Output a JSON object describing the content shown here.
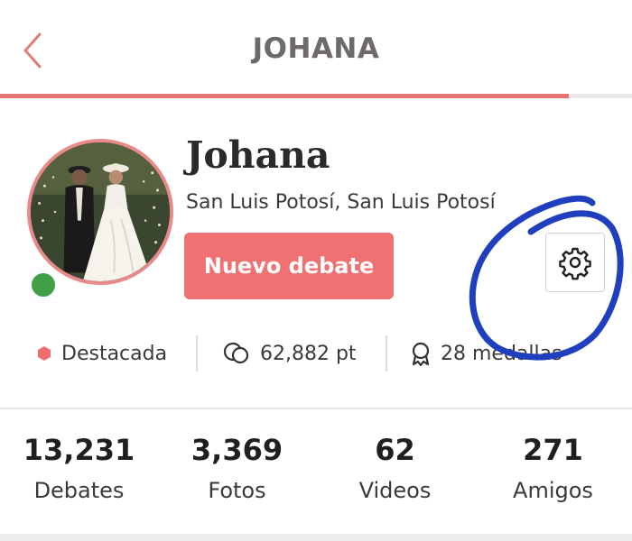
{
  "header": {
    "title": "JOHANA",
    "progress_fraction": 0.9
  },
  "profile": {
    "name": "Johana",
    "location": "San Luis Potosí, San Luis Potosí",
    "status": "online",
    "new_debate_label": "Nuevo debate"
  },
  "stats": [
    {
      "icon": "hexagon-icon",
      "label": "Destacada"
    },
    {
      "icon": "chat-bubbles-icon",
      "label": "62,882 pt"
    },
    {
      "icon": "medal-icon",
      "label": "28 medallas"
    }
  ],
  "counts": [
    {
      "value": "13,231",
      "label": "Debates"
    },
    {
      "value": "3,369",
      "label": "Fotos"
    },
    {
      "value": "62",
      "label": "Videos"
    },
    {
      "value": "271",
      "label": "Amigos"
    }
  ],
  "colors": {
    "accent": "#f07171",
    "progress": "#e57373",
    "online": "#3e9f47",
    "annotation": "#1f3fbf"
  }
}
